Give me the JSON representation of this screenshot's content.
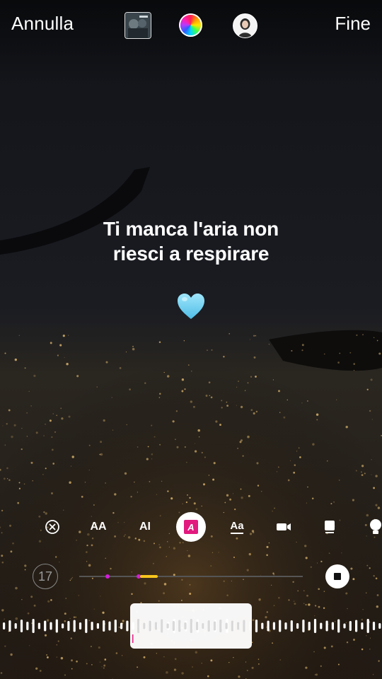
{
  "top_bar": {
    "cancel_label": "Annulla",
    "done_label": "Fine",
    "album_icon": "album-art-thumbnail",
    "color_icon": "color-wheel-icon",
    "avatar_icon": "profile-avatar"
  },
  "lyrics": {
    "line1": "Ti manca l'aria non",
    "line2": "riesci a respirare"
  },
  "sticker": {
    "icon": "light-blue-heart",
    "color": "#7dd6f2"
  },
  "style_options": [
    {
      "name": "remove-lyrics-icon"
    },
    {
      "name": "style-typewriter",
      "label": "AA"
    },
    {
      "name": "style-cursor",
      "label": "AI"
    },
    {
      "name": "style-highlight",
      "label": "A",
      "selected": true
    },
    {
      "name": "style-underline",
      "label": "Aa"
    },
    {
      "name": "video-icon"
    },
    {
      "name": "card-icon"
    },
    {
      "name": "bulb-icon"
    }
  ],
  "timeline": {
    "duration": "17",
    "progress": 0.35,
    "accent_color": "#f7c51d",
    "marker_color": "#d01ed8"
  },
  "colors": {
    "selected_style": "#e2197f"
  }
}
